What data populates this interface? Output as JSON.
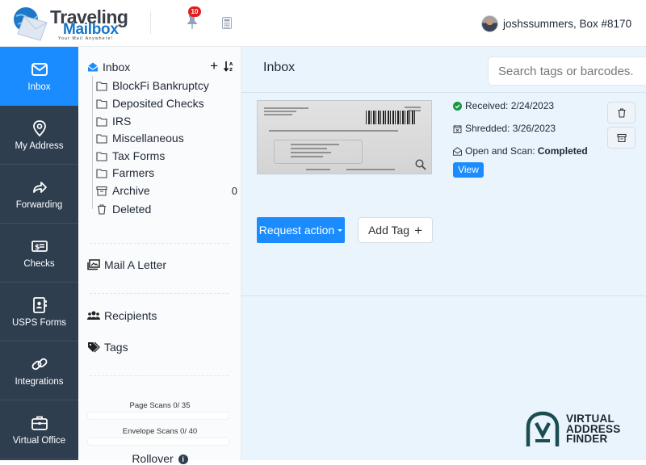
{
  "header": {
    "logo": {
      "line1": "Traveling",
      "line2": "Mailbox",
      "tagline": "Your Mail Anywhere!"
    },
    "notifications_count": "10",
    "user_label": "joshssummers, Box #8170"
  },
  "nav": {
    "items": [
      {
        "label": "Inbox",
        "icon": "envelope-icon",
        "active": true
      },
      {
        "label": "My Address",
        "icon": "location-pin-icon"
      },
      {
        "label": "Forwarding",
        "icon": "forward-arrow-icon"
      },
      {
        "label": "Checks",
        "icon": "check-icon"
      },
      {
        "label": "USPS Forms",
        "icon": "contact-book-icon"
      },
      {
        "label": "Integrations",
        "icon": "link-icon"
      },
      {
        "label": "Virtual Office",
        "icon": "briefcase-icon"
      }
    ]
  },
  "folders": {
    "root": "Inbox",
    "items": [
      {
        "label": "BlockFi Bankruptcy",
        "icon": "folder-icon"
      },
      {
        "label": "Deposited Checks",
        "icon": "folder-icon"
      },
      {
        "label": "IRS",
        "icon": "folder-icon"
      },
      {
        "label": "Miscellaneous",
        "icon": "folder-icon"
      },
      {
        "label": "Tax Forms",
        "icon": "folder-icon"
      },
      {
        "label": "Farmers",
        "icon": "folder-icon"
      },
      {
        "label": "Archive",
        "icon": "archive-icon",
        "count": "0"
      },
      {
        "label": "Deleted",
        "icon": "trash-icon"
      }
    ],
    "mail_letter": "Mail A Letter",
    "recipients": "Recipients",
    "tags": "Tags",
    "page_scans": {
      "label": "Page Scans 0/ 35",
      "used": 0,
      "total": 35
    },
    "envelope_scans": {
      "label": "Envelope Scans 0/ 40",
      "used": 0,
      "total": 40
    },
    "rollover": "Rollover"
  },
  "main": {
    "title": "Inbox",
    "search_placeholder": "Search tags or barcodes.",
    "mail": {
      "received": "Received: 2/24/2023",
      "shredded": "Shredded: 3/26/2023",
      "scan_label": "Open and Scan:",
      "scan_status": "Completed",
      "view": "View",
      "request_action": "Request action",
      "add_tag": "Add Tag"
    }
  },
  "watermark": {
    "line1": "VIRTUAL",
    "line2": "ADDRESS",
    "line3": "FINDER"
  },
  "colors": {
    "accent": "#1a8cff",
    "nav_bg": "#2e3e4f",
    "main_bg": "#eaf4fd",
    "badge": "#e11d1d"
  }
}
